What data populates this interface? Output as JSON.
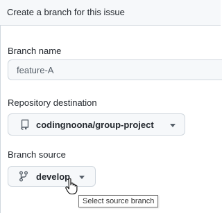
{
  "dialog": {
    "title": "Create a branch for this issue"
  },
  "branch_name": {
    "label": "Branch name",
    "value": "feature-A"
  },
  "repository": {
    "label": "Repository destination",
    "value": "codingnoona/group-project",
    "icon": "repo-icon"
  },
  "branch_source": {
    "label": "Branch source",
    "value": "develop",
    "icon": "git-branch-icon"
  },
  "tooltip": {
    "text": "Select source branch"
  },
  "colors": {
    "header_bg": "#f6f8fa",
    "border": "#d0d7de",
    "text": "#24292f"
  }
}
